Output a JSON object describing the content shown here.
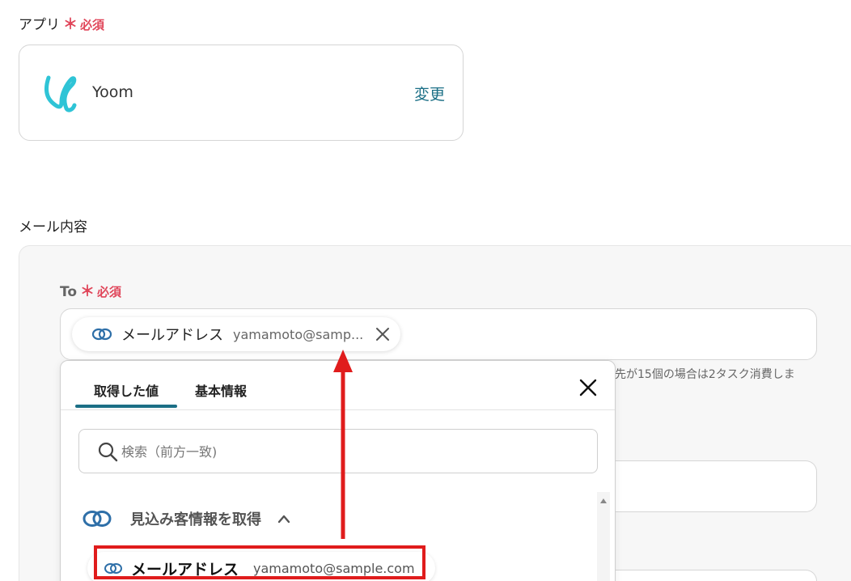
{
  "app_section": {
    "label": "アプリ",
    "required_star": "＊",
    "required_text": "必須",
    "app_name": "Yoom",
    "change_label": "変更"
  },
  "mail_section": {
    "label": "メール内容",
    "to_label": "To",
    "required_star": "＊",
    "required_text": "必須",
    "chip": {
      "label": "メールアドレス",
      "value": "yamamoto@samp..."
    },
    "hint_text": "先が15個の場合は2タスク消費しま"
  },
  "dropdown": {
    "tabs": [
      {
        "label": "取得した値",
        "active": true
      },
      {
        "label": "基本情報",
        "active": false
      }
    ],
    "search_placeholder": "検索（前方一致)",
    "group_label": "見込み客情報を取得",
    "item": {
      "label": "メールアドレス",
      "value": "yamamoto@sample.com"
    }
  },
  "colors": {
    "accent": "#1b6f86",
    "required": "#e0465a",
    "annotation_red": "#e01c1c",
    "logo": "#2fc4d6"
  },
  "icons": {
    "app_logo": "yoom-logo",
    "chip_icon": "link-rings-icon",
    "chip_close": "close-icon",
    "dropdown_close": "close-icon",
    "search": "search-icon",
    "group_icon": "link-rings-icon",
    "group_chevron": "chevron-up-icon"
  }
}
